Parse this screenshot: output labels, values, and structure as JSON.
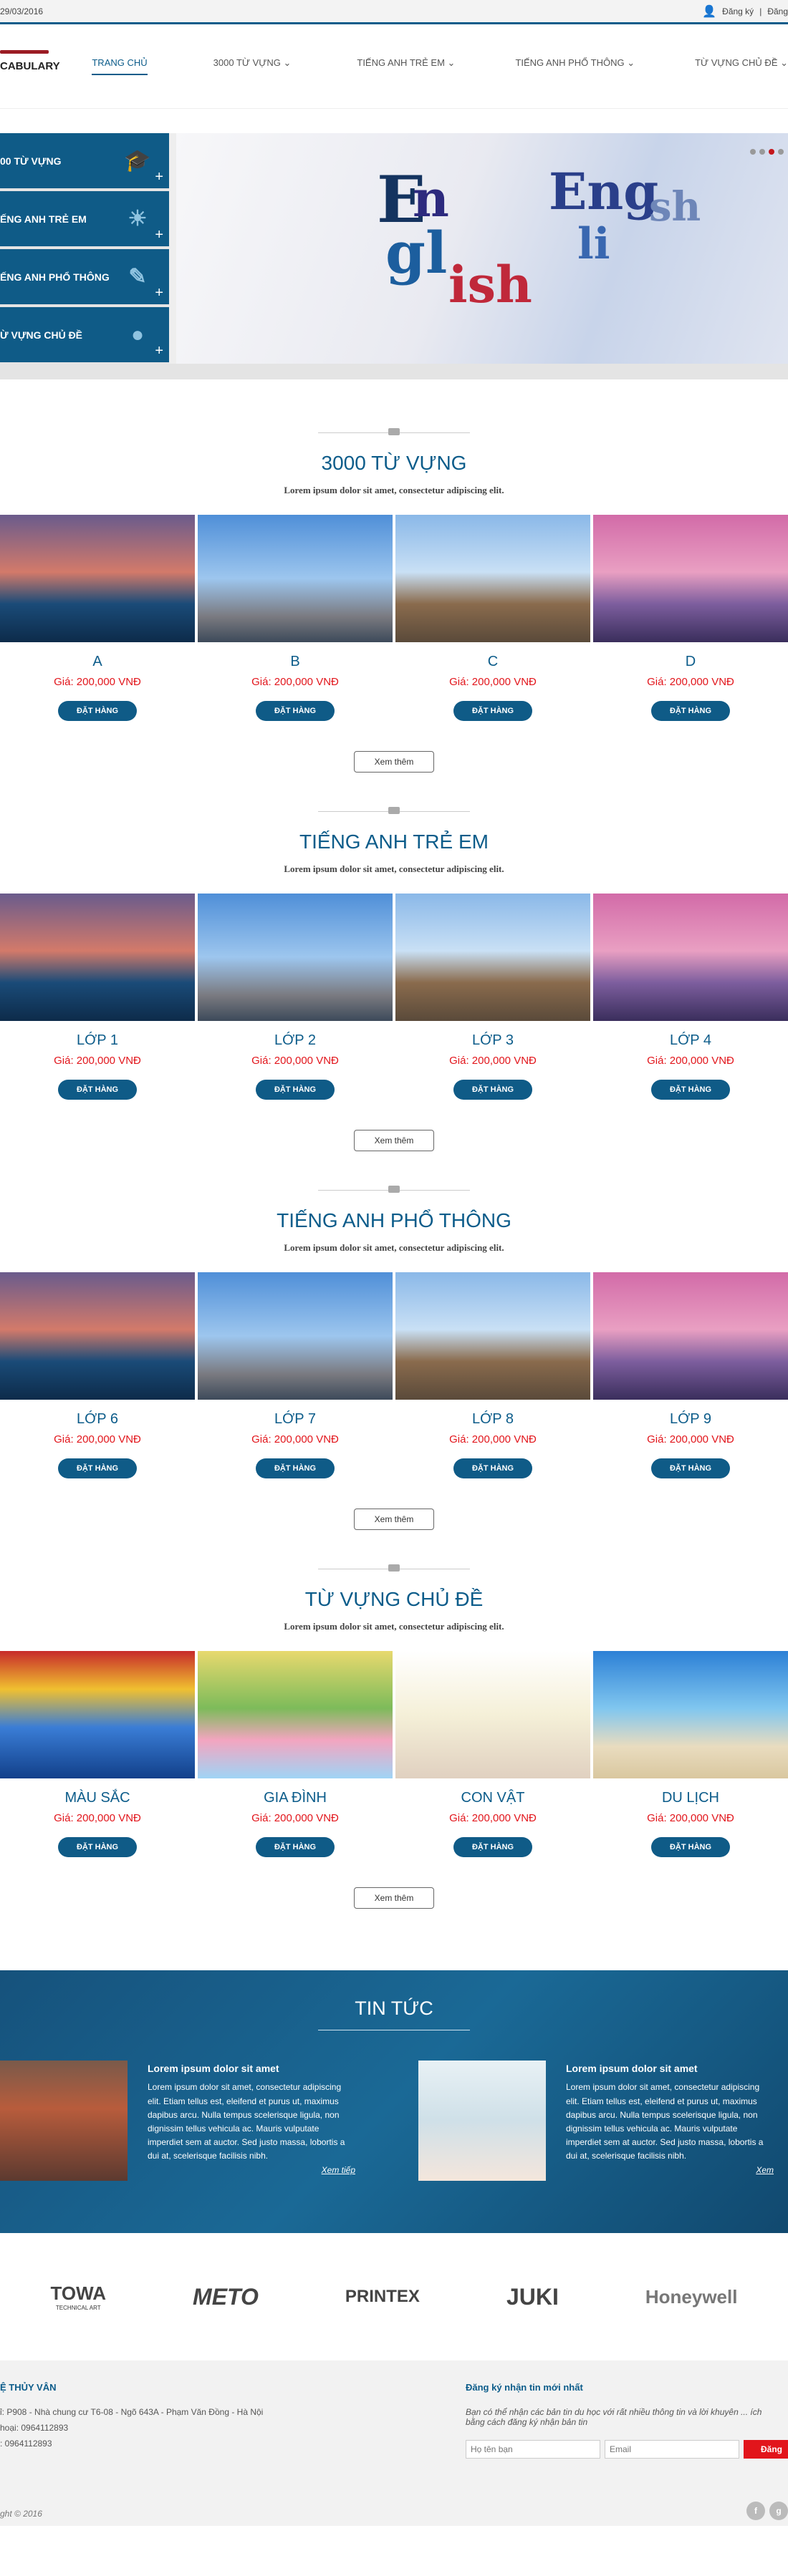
{
  "topbar": {
    "date": "29/03/2016",
    "login": "Đăng ký",
    "sep": "|",
    "register": "Đăng"
  },
  "logo": {
    "text": "CABULARY"
  },
  "nav": [
    "TRANG CHỦ",
    "3000 TỪ VỰNG ⌄",
    "TIẾNG ANH TRẺ EM ⌄",
    "TIẾNG ANH PHỔ THÔNG ⌄",
    "TỪ VỰNG CHỦ ĐỀ ⌄"
  ],
  "sidebar": [
    "00 TỪ VỰNG",
    "ẾNG ANH TRẺ EM",
    "ẾNG ANH PHỔ THÔNG",
    "Ừ VỰNG CHỦ ĐỀ"
  ],
  "slider": {
    "letters": [
      "E",
      "n",
      "gl",
      "ish",
      "Eng",
      "li",
      "sh"
    ]
  },
  "sections": [
    {
      "title": "3000 TỪ VỰNG",
      "sub": "Lorem ipsum dolor sit amet, consectetur adipiscing elit.",
      "cards": [
        {
          "name": "A",
          "price": "Giá: 200,000 VNĐ"
        },
        {
          "name": "B",
          "price": "Giá: 200,000 VNĐ"
        },
        {
          "name": "C",
          "price": "Giá: 200,000 VNĐ"
        },
        {
          "name": "D",
          "price": "Giá: 200,000 VNĐ"
        }
      ]
    },
    {
      "title": "TIẾNG ANH TRẺ EM",
      "sub": "Lorem ipsum dolor sit amet, consectetur adipiscing elit.",
      "cards": [
        {
          "name": "LỚP 1",
          "price": "Giá: 200,000 VNĐ"
        },
        {
          "name": "LỚP 2",
          "price": "Giá: 200,000 VNĐ"
        },
        {
          "name": "LỚP 3",
          "price": "Giá: 200,000 VNĐ"
        },
        {
          "name": "LỚP 4",
          "price": "Giá: 200,000 VNĐ"
        }
      ]
    },
    {
      "title": "TIẾNG ANH PHỔ THÔNG",
      "sub": "Lorem ipsum dolor sit amet, consectetur adipiscing elit.",
      "cards": [
        {
          "name": "LỚP 6",
          "price": "Giá: 200,000 VNĐ"
        },
        {
          "name": "LỚP 7",
          "price": "Giá: 200,000 VNĐ"
        },
        {
          "name": "LỚP 8",
          "price": "Giá: 200,000 VNĐ"
        },
        {
          "name": "LỚP 9",
          "price": "Giá: 200,000 VNĐ"
        }
      ]
    },
    {
      "title": "TỪ VỰNG CHỦ ĐỀ",
      "sub": "Lorem ipsum dolor sit amet, consectetur adipiscing elit.",
      "cards": [
        {
          "name": "MÀU SẮC",
          "price": "Giá: 200,000 VNĐ"
        },
        {
          "name": "GIA ĐÌNH",
          "price": "Giá: 200,000 VNĐ"
        },
        {
          "name": "CON VẬT",
          "price": "Giá: 200,000 VNĐ"
        },
        {
          "name": "DU LỊCH",
          "price": "Giá: 200,000 VNĐ"
        }
      ]
    }
  ],
  "buttons": {
    "order": "ĐẶT HÀNG",
    "more": "Xem thêm"
  },
  "news": {
    "title": "TIN TỨC",
    "items": [
      {
        "title": "Lorem ipsum dolor sit amet",
        "body": "Lorem ipsum dolor sit amet, consectetur adipiscing elit. Etiam tellus est, eleifend et purus ut, maximus dapibus arcu. Nulla tempus scelerisque ligula, non dignissim tellus vehicula ac. Mauris vulputate imperdiet sem at auctor. Sed justo massa, lobortis a dui at, scelerisque facilisis nibh.",
        "link": "Xem tiếp"
      },
      {
        "title": "Lorem ipsum dolor sit amet",
        "body": "Lorem ipsum dolor sit amet, consectetur adipiscing elit. Etiam tellus est, eleifend et purus ut, maximus dapibus arcu. Nulla tempus scelerisque ligula, non dignissim tellus vehicula ac. Mauris vulputate imperdiet sem at auctor. Sed justo massa, lobortis a dui at, scelerisque facilisis nibh.",
        "link": "Xem"
      }
    ]
  },
  "brands": [
    "TOWA",
    "METO",
    "PRINTEX",
    "JUKI",
    "Honeywell"
  ],
  "brand_sub": "TECHNICAL ART",
  "footer": {
    "left_title": "Ệ THỦY VÂN",
    "address": "ỉ: P908 - Nhà chung cư T6-08 - Ngõ 643A - Phạm Văn Đồng - Hà Nội",
    "phone": "hoại: 0964112893",
    "mobile": ": 0964112893",
    "right_title": "Đăng ký nhận tin mới nhất",
    "right_text": "Bạn có thể nhận các bản tin du học với rất nhiều thông tin và lời khuyên ... ích bằng cách đăng ký nhận bản tin",
    "name_ph": "Họ tên bạn",
    "email_ph": "Email",
    "submit": "Đăng",
    "copyright": "ght © 2016"
  }
}
